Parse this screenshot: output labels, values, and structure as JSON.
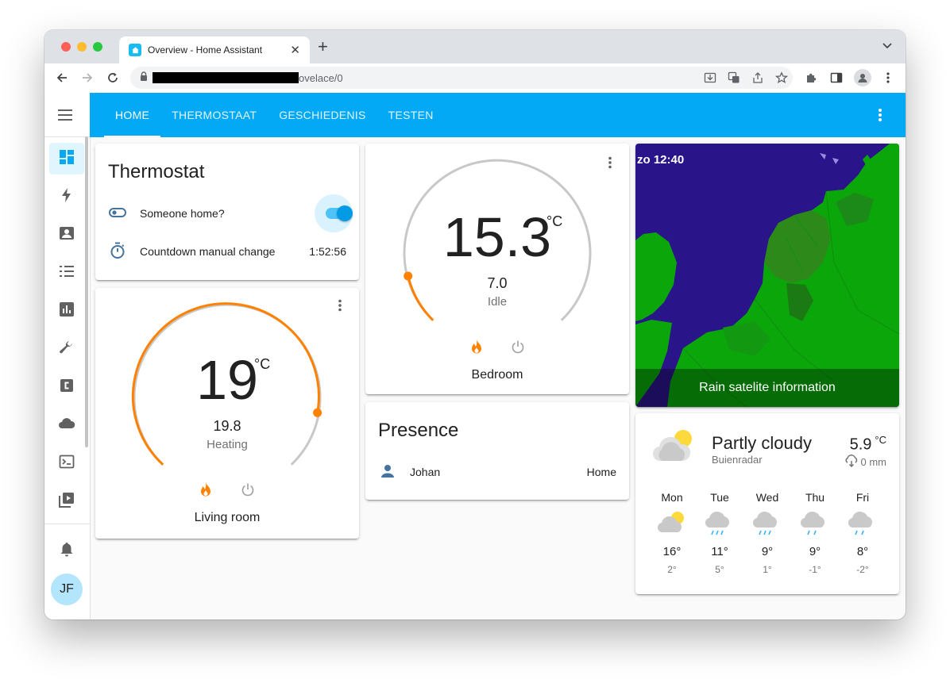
{
  "browser": {
    "tab_title": "Overview - Home Assistant",
    "url_visible": "ovelace/0"
  },
  "header": {
    "tabs": [
      {
        "label": "HOME",
        "active": true
      },
      {
        "label": "THERMOSTAAT",
        "active": false
      },
      {
        "label": "GESCHIEDENIS",
        "active": false
      },
      {
        "label": "TESTEN",
        "active": false
      }
    ],
    "accent": "#03a9f4"
  },
  "sidebar": {
    "items": [
      {
        "icon": "dashboard-icon",
        "active": true
      },
      {
        "icon": "lightning-bolt-icon"
      },
      {
        "icon": "account-box-icon"
      },
      {
        "icon": "format-list-checks-icon"
      },
      {
        "icon": "chart-box-icon"
      },
      {
        "icon": "wrench-icon"
      },
      {
        "icon": "alpha-c-box-icon"
      },
      {
        "icon": "cloud-icon"
      },
      {
        "icon": "console-icon"
      },
      {
        "icon": "play-box-multiple-icon"
      }
    ],
    "notifications_icon": "bell-icon",
    "avatar_initials": "JF"
  },
  "thermostat_entities": {
    "title": "Thermostat",
    "rows": [
      {
        "icon": "toggle-switch-icon",
        "name": "Someone home?",
        "state": "on"
      },
      {
        "icon": "timer-icon",
        "name": "Countdown manual change",
        "value": "1:52:56"
      }
    ]
  },
  "living_room": {
    "temperature": "19",
    "unit": "°C",
    "target": "19.8",
    "mode": "Heating",
    "name": "Living room",
    "heat_color": "#ff8100"
  },
  "bedroom": {
    "temperature": "15.3",
    "unit": "°C",
    "target": "7.0",
    "mode": "Idle",
    "name": "Bedroom"
  },
  "presence": {
    "title": "Presence",
    "rows": [
      {
        "icon": "account-icon",
        "name": "Johan",
        "state": "Home"
      }
    ]
  },
  "radar": {
    "time": "zo 12:40",
    "caption": "Rain satelite information"
  },
  "weather": {
    "state": "Partly cloudy",
    "source": "Buienradar",
    "temperature": "5.9",
    "unit": "°C",
    "precipitation": "0 mm",
    "forecast": [
      {
        "day": "Mon",
        "icon": "partly-cloudy-icon",
        "high": "16°",
        "low": "2°"
      },
      {
        "day": "Tue",
        "icon": "rainy-icon",
        "high": "11°",
        "low": "5°"
      },
      {
        "day": "Wed",
        "icon": "rainy-icon",
        "high": "9°",
        "low": "1°"
      },
      {
        "day": "Thu",
        "icon": "rainy-icon",
        "high": "9°",
        "low": "-1°"
      },
      {
        "day": "Fri",
        "icon": "rainy-icon",
        "high": "8°",
        "low": "-2°"
      }
    ]
  }
}
